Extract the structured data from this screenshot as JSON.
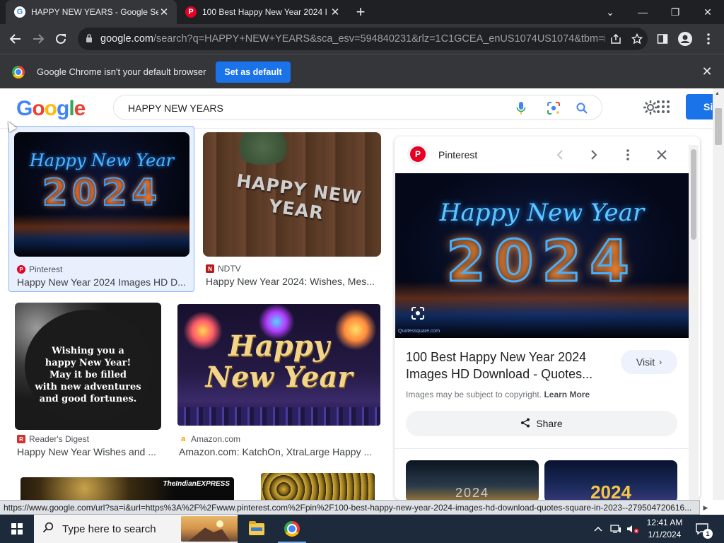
{
  "browser": {
    "tabs": [
      {
        "title": "HAPPY NEW YEARS - Google Se",
        "icon": "google-favicon-icon",
        "active": true
      },
      {
        "title": "100 Best Happy New Year 2024 I",
        "icon": "pinterest-favicon-icon",
        "active": false
      }
    ],
    "new_tab": "+",
    "window_controls": {
      "dropdown": "⌄",
      "minimize": "—",
      "restore": "❐",
      "close": "✕"
    },
    "url_host": "google.com",
    "url_path": "/search?q=HAPPY+NEW+YEARS&sca_esv=594840231&rlz=1C1GCEA_enUS1074US1074&tbm=isch...",
    "infobar_text": "Google Chrome isn't your default browser",
    "set_default_label": "Set as default"
  },
  "google": {
    "logo_letters": [
      "G",
      "o",
      "o",
      "g",
      "l",
      "e"
    ],
    "query": "HAPPY NEW YEARS",
    "signin_label": "Si"
  },
  "results": [
    {
      "source": "Pinterest",
      "title": "Happy New Year 2024 Images HD D...",
      "icon": "pinterest-icon",
      "image_text": [
        "Happy New Year",
        "2024"
      ]
    },
    {
      "source": "NDTV",
      "title": "Happy New Year 2024: Wishes, Mes...",
      "icon": "ndtv-icon",
      "image_text": [
        "HAPPY NEW YEAR"
      ]
    },
    {
      "source": "Reader's Digest",
      "title": "Happy New Year Wishes and ...",
      "icon": "readers-digest-icon",
      "image_text": [
        "Wishing you a",
        "happy New Year!",
        "May it be filled",
        "with new adventures",
        "and good fortunes."
      ]
    },
    {
      "source": "Amazon.com",
      "title": "Amazon.com: KatchOn, XtraLarge Happy ...",
      "icon": "amazon-icon",
      "image_text": [
        "Happy",
        "New Year"
      ]
    }
  ],
  "bottom_row": {
    "indian_express_text": "TheIndianEXPRESS"
  },
  "panel": {
    "source": "Pinterest",
    "hero_text": [
      "Happy New Year",
      "2024"
    ],
    "hero_watermark": "Quotessquare.com",
    "title_line1": "100 Best Happy New Year 2024",
    "title_line2": "Images HD Download - Quotes...",
    "visit_label": "Visit",
    "copyright_text": "Images may be subject to copyright.",
    "learn_more": "Learn More",
    "share_label": "Share",
    "related": [
      {
        "text": "2024"
      },
      {
        "text": "2024"
      }
    ]
  },
  "status_url": "https://www.google.com/url?sa=i&url=https%3A%2F%2Fwww.pinterest.com%2Fpin%2F100-best-happy-new-year-2024-images-hd-download-quotes-square-in-2023--279504720616...",
  "taskbar": {
    "search_placeholder": "Type here to search",
    "time": "12:41 AM",
    "date": "1/1/2024",
    "notification_count": "1"
  },
  "colors": {
    "chrome_dark": "#1f2023",
    "chrome_toolbar": "#35363a",
    "google_blue": "#4285f4",
    "google_red": "#ea4335",
    "google_yellow": "#fbbc04",
    "google_green": "#34a853",
    "button_blue": "#1a73e8",
    "taskbar": "#1c2a3b",
    "pinterest_red": "#e60023"
  }
}
